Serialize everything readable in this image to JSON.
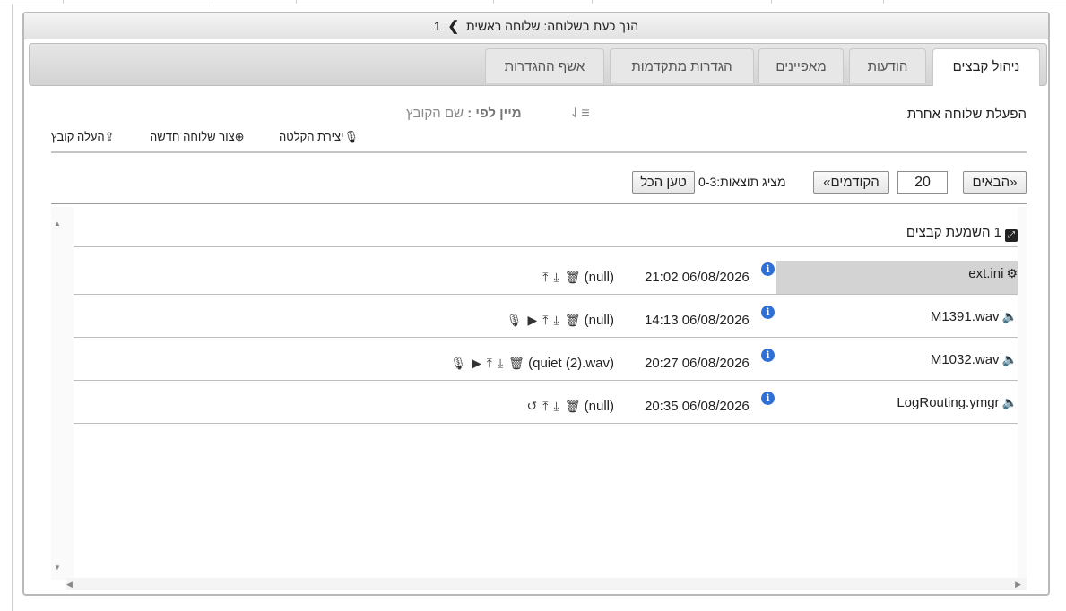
{
  "panel": {
    "title_prefix": "הנך כעת בשלוחה: שלוחה ראשית",
    "title_chevron": "❯",
    "title_suffix": "1"
  },
  "tabs": [
    {
      "label": "ניהול קבצים",
      "active": true
    },
    {
      "label": "הודעות",
      "active": false
    },
    {
      "label": "מאפיינים",
      "active": false
    },
    {
      "label": "הגדרות מתקדמות",
      "active": false
    },
    {
      "label": "אשף ההגדרות",
      "active": false
    }
  ],
  "header": {
    "activate_other": "הפעלת שלוחה אחרת",
    "sort_label": "מיין לפי :",
    "sort_value": "שם הקובץ"
  },
  "toolbar": {
    "create_recording": "יצירת הקלטה",
    "create_extension": "צור שלוחה חדשה",
    "upload_file": "העלה קובץ"
  },
  "pager": {
    "next": "«הבאים",
    "page_size": "20",
    "prev": "הקודמים»",
    "showing": "מציג תוצאות:0-3",
    "load_all": "טען הכל"
  },
  "list": {
    "group_count": "1",
    "group_label": "השמעת קבצים",
    "rows": [
      {
        "name": "ext.ini",
        "icon": "gears-icon",
        "date": "21:02 06/08/2026",
        "target": "(null)",
        "actions": [
          "upload-icon",
          "download-icon",
          "trash-icon"
        ]
      },
      {
        "name": "M1391.wav",
        "icon": "speaker-icon",
        "date": "14:13 06/08/2026",
        "target": "(null)",
        "actions": [
          "mic-icon",
          "play-icon",
          "upload-icon",
          "download-icon",
          "trash-icon"
        ]
      },
      {
        "name": "M1032.wav",
        "icon": "speaker-icon",
        "date": "20:27 06/08/2026",
        "target": "(quiet (2).wav)",
        "actions": [
          "mic-icon",
          "play-icon",
          "upload-icon",
          "download-icon",
          "trash-icon"
        ]
      },
      {
        "name": "LogRouting.ymgr",
        "icon": "speaker-icon",
        "date": "20:35 06/08/2026",
        "target": "(null)",
        "actions": [
          "history-icon",
          "upload-icon",
          "download-icon",
          "trash-icon"
        ]
      }
    ]
  },
  "colors": {
    "info": "#2f6fd6",
    "highlight": "#d3d3d3"
  }
}
